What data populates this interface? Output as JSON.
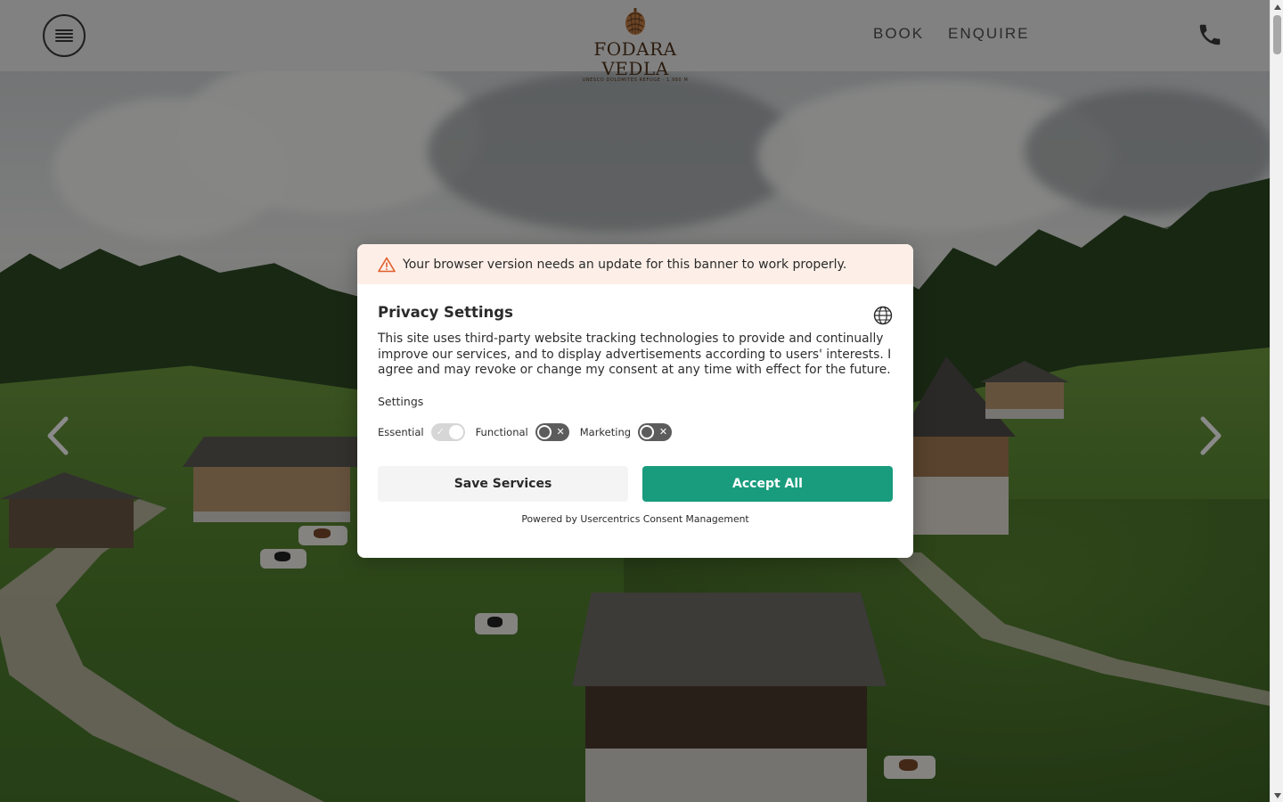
{
  "header": {
    "menu_icon": "hamburger-menu-icon",
    "logo": {
      "name": "FODARA VEDLA",
      "tagline": "UNESCO DOLOMITES REFUGE · 1.980 M"
    },
    "nav": [
      {
        "label": "BOOK"
      },
      {
        "label": "ENQUIRE"
      }
    ],
    "phone_icon": "phone-icon"
  },
  "carousel": {
    "prev_icon": "chevron-left-icon",
    "next_icon": "chevron-right-icon"
  },
  "consent": {
    "warning": "Your browser version needs an update for this banner to work properly.",
    "title": "Privacy Settings",
    "description": "This site uses third-party website tracking technologies to provide and continually improve our services, and to display advertisements according to users' interests. I agree and may revoke or change my consent at any time with effect for the future.",
    "settings_label": "Settings",
    "toggles": [
      {
        "label": "Essential",
        "state": "on",
        "locked": true
      },
      {
        "label": "Functional",
        "state": "off",
        "locked": false
      },
      {
        "label": "Marketing",
        "state": "off",
        "locked": false
      }
    ],
    "save_label": "Save Services",
    "accept_label": "Accept All",
    "powered_by": "Powered by Usercentrics Consent Management",
    "colors": {
      "accept": "#199c7d",
      "warning_bg": "#fdefe7",
      "warning_icon": "#e05d2a"
    }
  }
}
